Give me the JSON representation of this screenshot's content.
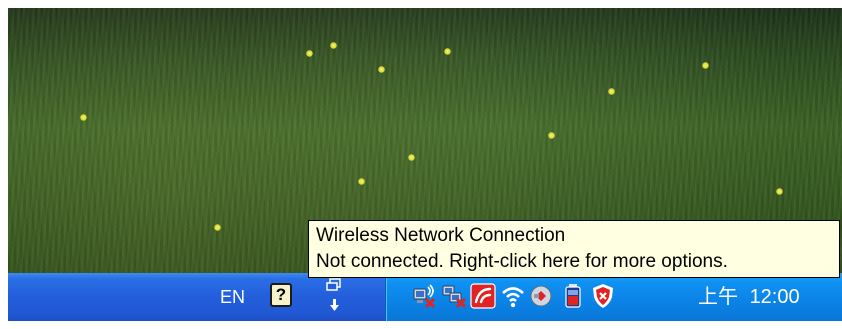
{
  "tooltip": {
    "title": "Wireless Network Connection",
    "message": "Not connected. Right-click here for more options."
  },
  "taskbar": {
    "language_indicator": "EN",
    "help_icon_glyph": "?",
    "restore_icon": "taskbar-restore-icon"
  },
  "tray": {
    "icons": [
      "wireless-signal-icon",
      "network-disconnected-icon",
      "antivirus-icon",
      "wifi-icon",
      "power-plug-icon",
      "battery-icon",
      "security-center-alert-icon"
    ],
    "clock_period": "上午",
    "clock_time": "12:00"
  },
  "colors": {
    "taskbar_blue": "#245edb",
    "tray_blue": "#0b83e6",
    "tooltip_bg": "#ffffe1",
    "alert_red": "#e02424"
  }
}
